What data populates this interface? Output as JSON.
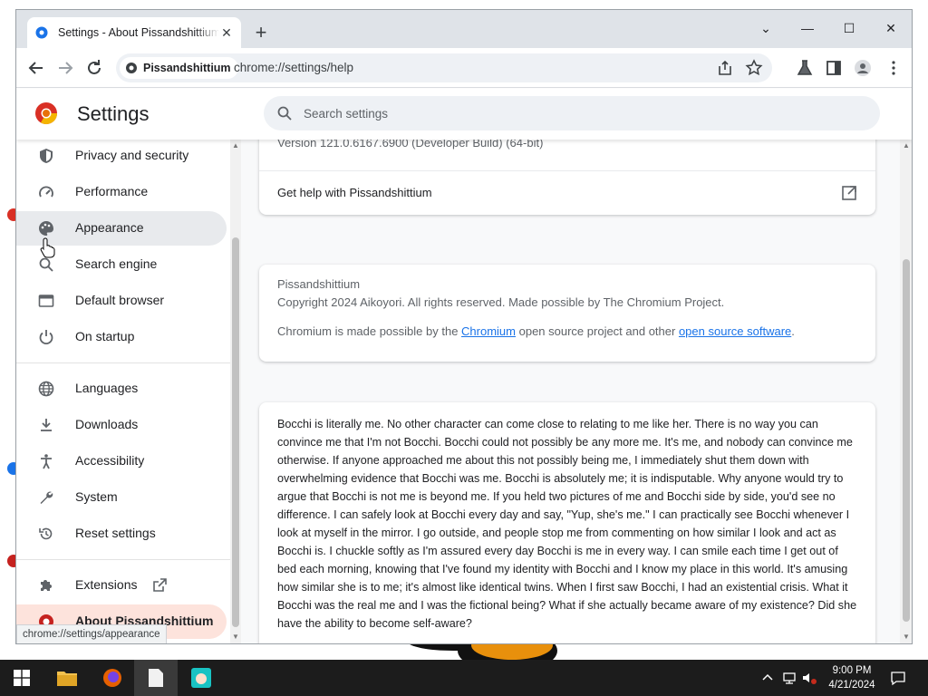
{
  "browser": {
    "tab_title": "Settings - About Pissandshittium",
    "site_chip": "Pissandshittium",
    "url": "chrome://settings/help",
    "status_url": "chrome://settings/appearance"
  },
  "settings": {
    "title": "Settings",
    "search_placeholder": "Search settings"
  },
  "sidebar": {
    "items": [
      {
        "label": "Privacy and security",
        "icon": "shield-icon"
      },
      {
        "label": "Performance",
        "icon": "speedometer-icon"
      },
      {
        "label": "Appearance",
        "icon": "palette-icon"
      },
      {
        "label": "Search engine",
        "icon": "search-icon"
      },
      {
        "label": "Default browser",
        "icon": "browser-window-icon"
      },
      {
        "label": "On startup",
        "icon": "power-icon"
      },
      {
        "label": "Languages",
        "icon": "globe-icon"
      },
      {
        "label": "Downloads",
        "icon": "download-icon"
      },
      {
        "label": "Accessibility",
        "icon": "accessibility-icon"
      },
      {
        "label": "System",
        "icon": "wrench-icon"
      },
      {
        "label": "Reset settings",
        "icon": "restore-icon"
      },
      {
        "label": "Extensions",
        "icon": "puzzle-icon"
      },
      {
        "label": "About Pissandshittium",
        "icon": "logo-icon"
      }
    ]
  },
  "about": {
    "version": "Version 121.0.6167.6900 (Developer Build) (64-bit)",
    "help_label": "Get help with Pissandshittium",
    "product_name": "Pissandshittium",
    "copyright": "Copyright 2024 Aikoyori. All rights reserved. Made possible by The Chromium Project.",
    "credits_prefix": "Chromium is made possible by the ",
    "credits_link1": "Chromium",
    "credits_middle": " open source project and other ",
    "credits_link2": "open source software",
    "credits_suffix": "."
  },
  "bocchi_text": "Bocchi is literally me. No other character can come close to relating to me like her. There is no way you can convince me that I'm not Bocchi. Bocchi could not possibly be any more me. It's me, and nobody can convince me otherwise. If anyone approached me about this not possibly being me, I immediately shut them down with overwhelming evidence that Bocchi was me. Bocchi is absolutely me; it is indisputable. Why anyone would try to argue that Bocchi is not me is beyond me. If you held two pictures of me and Bocchi side by side, you'd see no difference. I can safely look at Bocchi every day and say, \"Yup, she's me.\" I can practically see Bocchi whenever I look at myself in the mirror. I go outside, and people stop me from commenting on how similar I look and act as Bocchi is. I chuckle softly as I'm assured every day Bocchi is me in every way. I can smile each time I get out of bed each morning, knowing that I've found my identity with Bocchi and I know my place in this world. It's amusing how similar she is to me; it's almost like identical twins. When I first saw Bocchi, I had an existential crisis. What it Bocchi was the real me and I was the fictional being? What if she actually became aware of my existence? Did she have the ability to become self-aware?",
  "taskbar": {
    "time": "9:00 PM",
    "date": "4/21/2024"
  },
  "colors": {
    "accent": "#1a73e8",
    "active_nav_bg": "#fde3dc",
    "hover_nav_bg": "#e8eaed",
    "titlebar_bg": "#dfe3e8"
  }
}
